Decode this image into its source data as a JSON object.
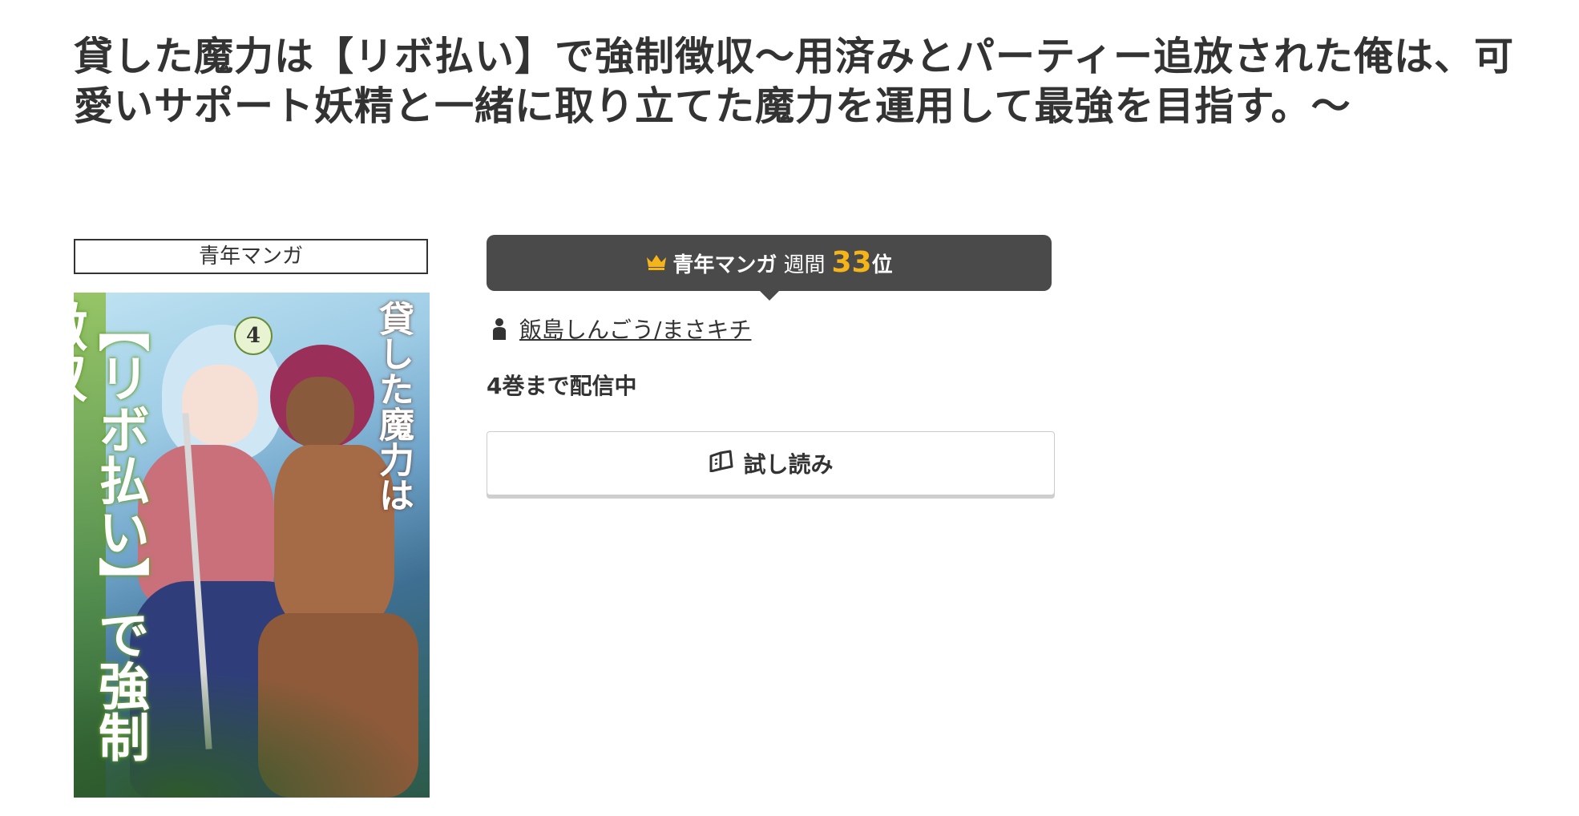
{
  "title": "貸した魔力は【リボ払い】で強制徴収〜用済みとパーティー追放された俺は、可愛いサポート妖精と一緒に取り立てた魔力を運用して最強を目指す。〜",
  "category": "青年マンガ",
  "cover": {
    "volume": "4",
    "title_text": "【リボ払い】で強制徴収",
    "subtitle_text": "貸した魔力は"
  },
  "ranking": {
    "category": "青年マンガ",
    "period": "週間",
    "rank": "33",
    "suffix": "位",
    "crown_color": "#f5b418"
  },
  "author": {
    "name": "飯島しんごう/まさキチ",
    "icon": "person-icon"
  },
  "volume_status": "4巻まで配信中",
  "trial_button": {
    "label": "試し読み",
    "icon": "open-book-icon"
  }
}
